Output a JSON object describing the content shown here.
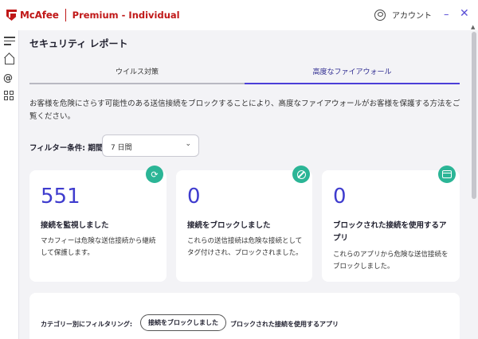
{
  "app": {
    "brand": "McAfee",
    "product": "Premium - Individual",
    "account_label": "アカウント",
    "minimize_glyph": "–",
    "close_glyph": "✕"
  },
  "page": {
    "title": "セキュリティ レポート",
    "tabs": [
      {
        "label": "ウイルス対策",
        "active": false
      },
      {
        "label": "高度なファイアウォール",
        "active": true
      }
    ],
    "description": "お客様を危険にさらす可能性のある送信接続をブロックすることにより、高度なファイアウォールがお客様を保護する方法をご覧ください。"
  },
  "filter": {
    "label": "フィルター条件: 期間",
    "selected": "7 日間"
  },
  "cards": [
    {
      "value": "551",
      "title": "接続を監視しました",
      "description": "マカフィーは危険な送信接続から継続して保護します。",
      "icon": "refresh-icon"
    },
    {
      "value": "0",
      "title": "接続をブロックしました",
      "description": "これらの送信接続は危険な接続としてタグ付けされ、ブロックされました。",
      "icon": "block-icon"
    },
    {
      "value": "0",
      "title": "ブロックされた接続を使用するアプリ",
      "description": "これらのアプリから危険な送信接続をブロックしました。",
      "icon": "app-window-icon"
    }
  ],
  "category_filter": {
    "label": "カテゴリー別にフィルタリング:",
    "options": [
      {
        "label": "接続をブロックしました",
        "active": true
      },
      {
        "label": "ブロックされた接続を使用するアプリ",
        "active": false
      }
    ]
  },
  "colors": {
    "brand_red": "#c01818",
    "accent": "#4b3fd8",
    "badge_green": "#2bb596",
    "value_blue": "#3f3cce"
  }
}
